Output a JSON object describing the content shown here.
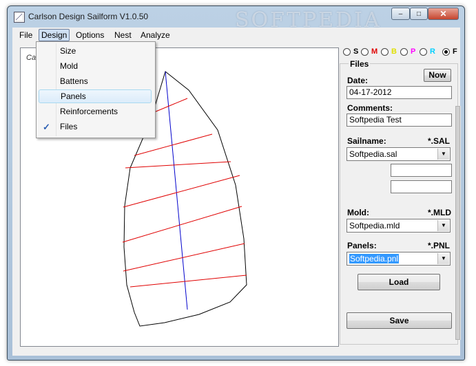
{
  "window": {
    "title": "Carlson Design Sailform V1.0.50",
    "watermark": "SOFTPEDIA",
    "min_glyph": "–",
    "max_glyph": "□",
    "close_glyph": "✕"
  },
  "menubar": {
    "items": [
      "File",
      "Design",
      "Options",
      "Nest",
      "Analyze"
    ]
  },
  "design_menu": {
    "items": [
      "Size",
      "Mold",
      "Battens",
      "Panels",
      "Reinforcements",
      "Files"
    ],
    "highlighted": "Panels",
    "checked": "Files",
    "check_glyph": "✓"
  },
  "canvas": {
    "label": "Ca",
    "colors": {
      "outline": "#000000",
      "panel_seams": "#e00000",
      "mid_line": "#0000cc"
    }
  },
  "radios": [
    {
      "label": "S",
      "color": "#000000"
    },
    {
      "label": "M",
      "color": "#e00000"
    },
    {
      "label": "B",
      "color": "#e0e000"
    },
    {
      "label": "P",
      "color": "#ff00ff"
    },
    {
      "label": "R",
      "color": "#00d0ff"
    },
    {
      "label": "F",
      "color": "#000000",
      "selected": true
    }
  ],
  "files_panel": {
    "title": "Files",
    "now_button": "Now",
    "date_label": "Date:",
    "date_value": "04-17-2012",
    "comments_label": "Comments:",
    "comments_value": "Softpedia Test",
    "sailname_label": "Sailname:",
    "sailname_ext": "*.SAL",
    "sailname_value": "Softpedia.sal",
    "extra_field_1": "",
    "extra_field_2": "",
    "mold_label": "Mold:",
    "mold_ext": "*.MLD",
    "mold_value": "Softpedia.mld",
    "panels_label": "Panels:",
    "panels_ext": "*.PNL",
    "panels_value": "Softpedia.pnl",
    "load_button": "Load",
    "save_button": "Save",
    "dropdown_glyph": "▼"
  }
}
